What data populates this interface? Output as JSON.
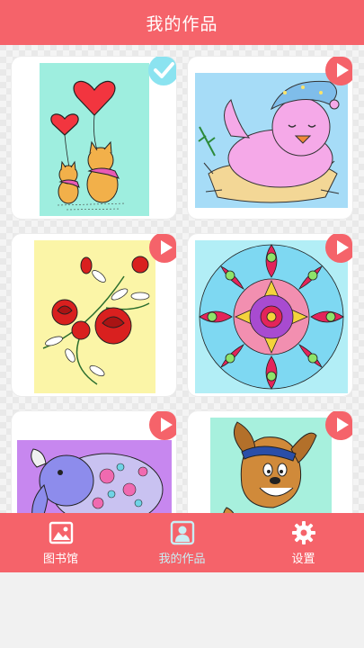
{
  "header": {
    "title": "我的作品"
  },
  "works": [
    {
      "name": "cats-with-heart-balloons",
      "status": "completed"
    },
    {
      "name": "bird-in-nest",
      "status": "in-progress"
    },
    {
      "name": "red-roses",
      "status": "in-progress"
    },
    {
      "name": "mandala",
      "status": "in-progress"
    },
    {
      "name": "elephant",
      "status": "in-progress"
    },
    {
      "name": "cartoon-dog",
      "status": "in-progress"
    }
  ],
  "nav": {
    "items": [
      {
        "label": "图书馆",
        "icon": "image-icon"
      },
      {
        "label": "我的作品",
        "icon": "portrait-icon",
        "active": true
      },
      {
        "label": "设置",
        "icon": "gear-icon"
      }
    ]
  },
  "colors": {
    "accent": "#f5636a",
    "check": "#8be3f0",
    "active_tab": "#c9eef4"
  }
}
